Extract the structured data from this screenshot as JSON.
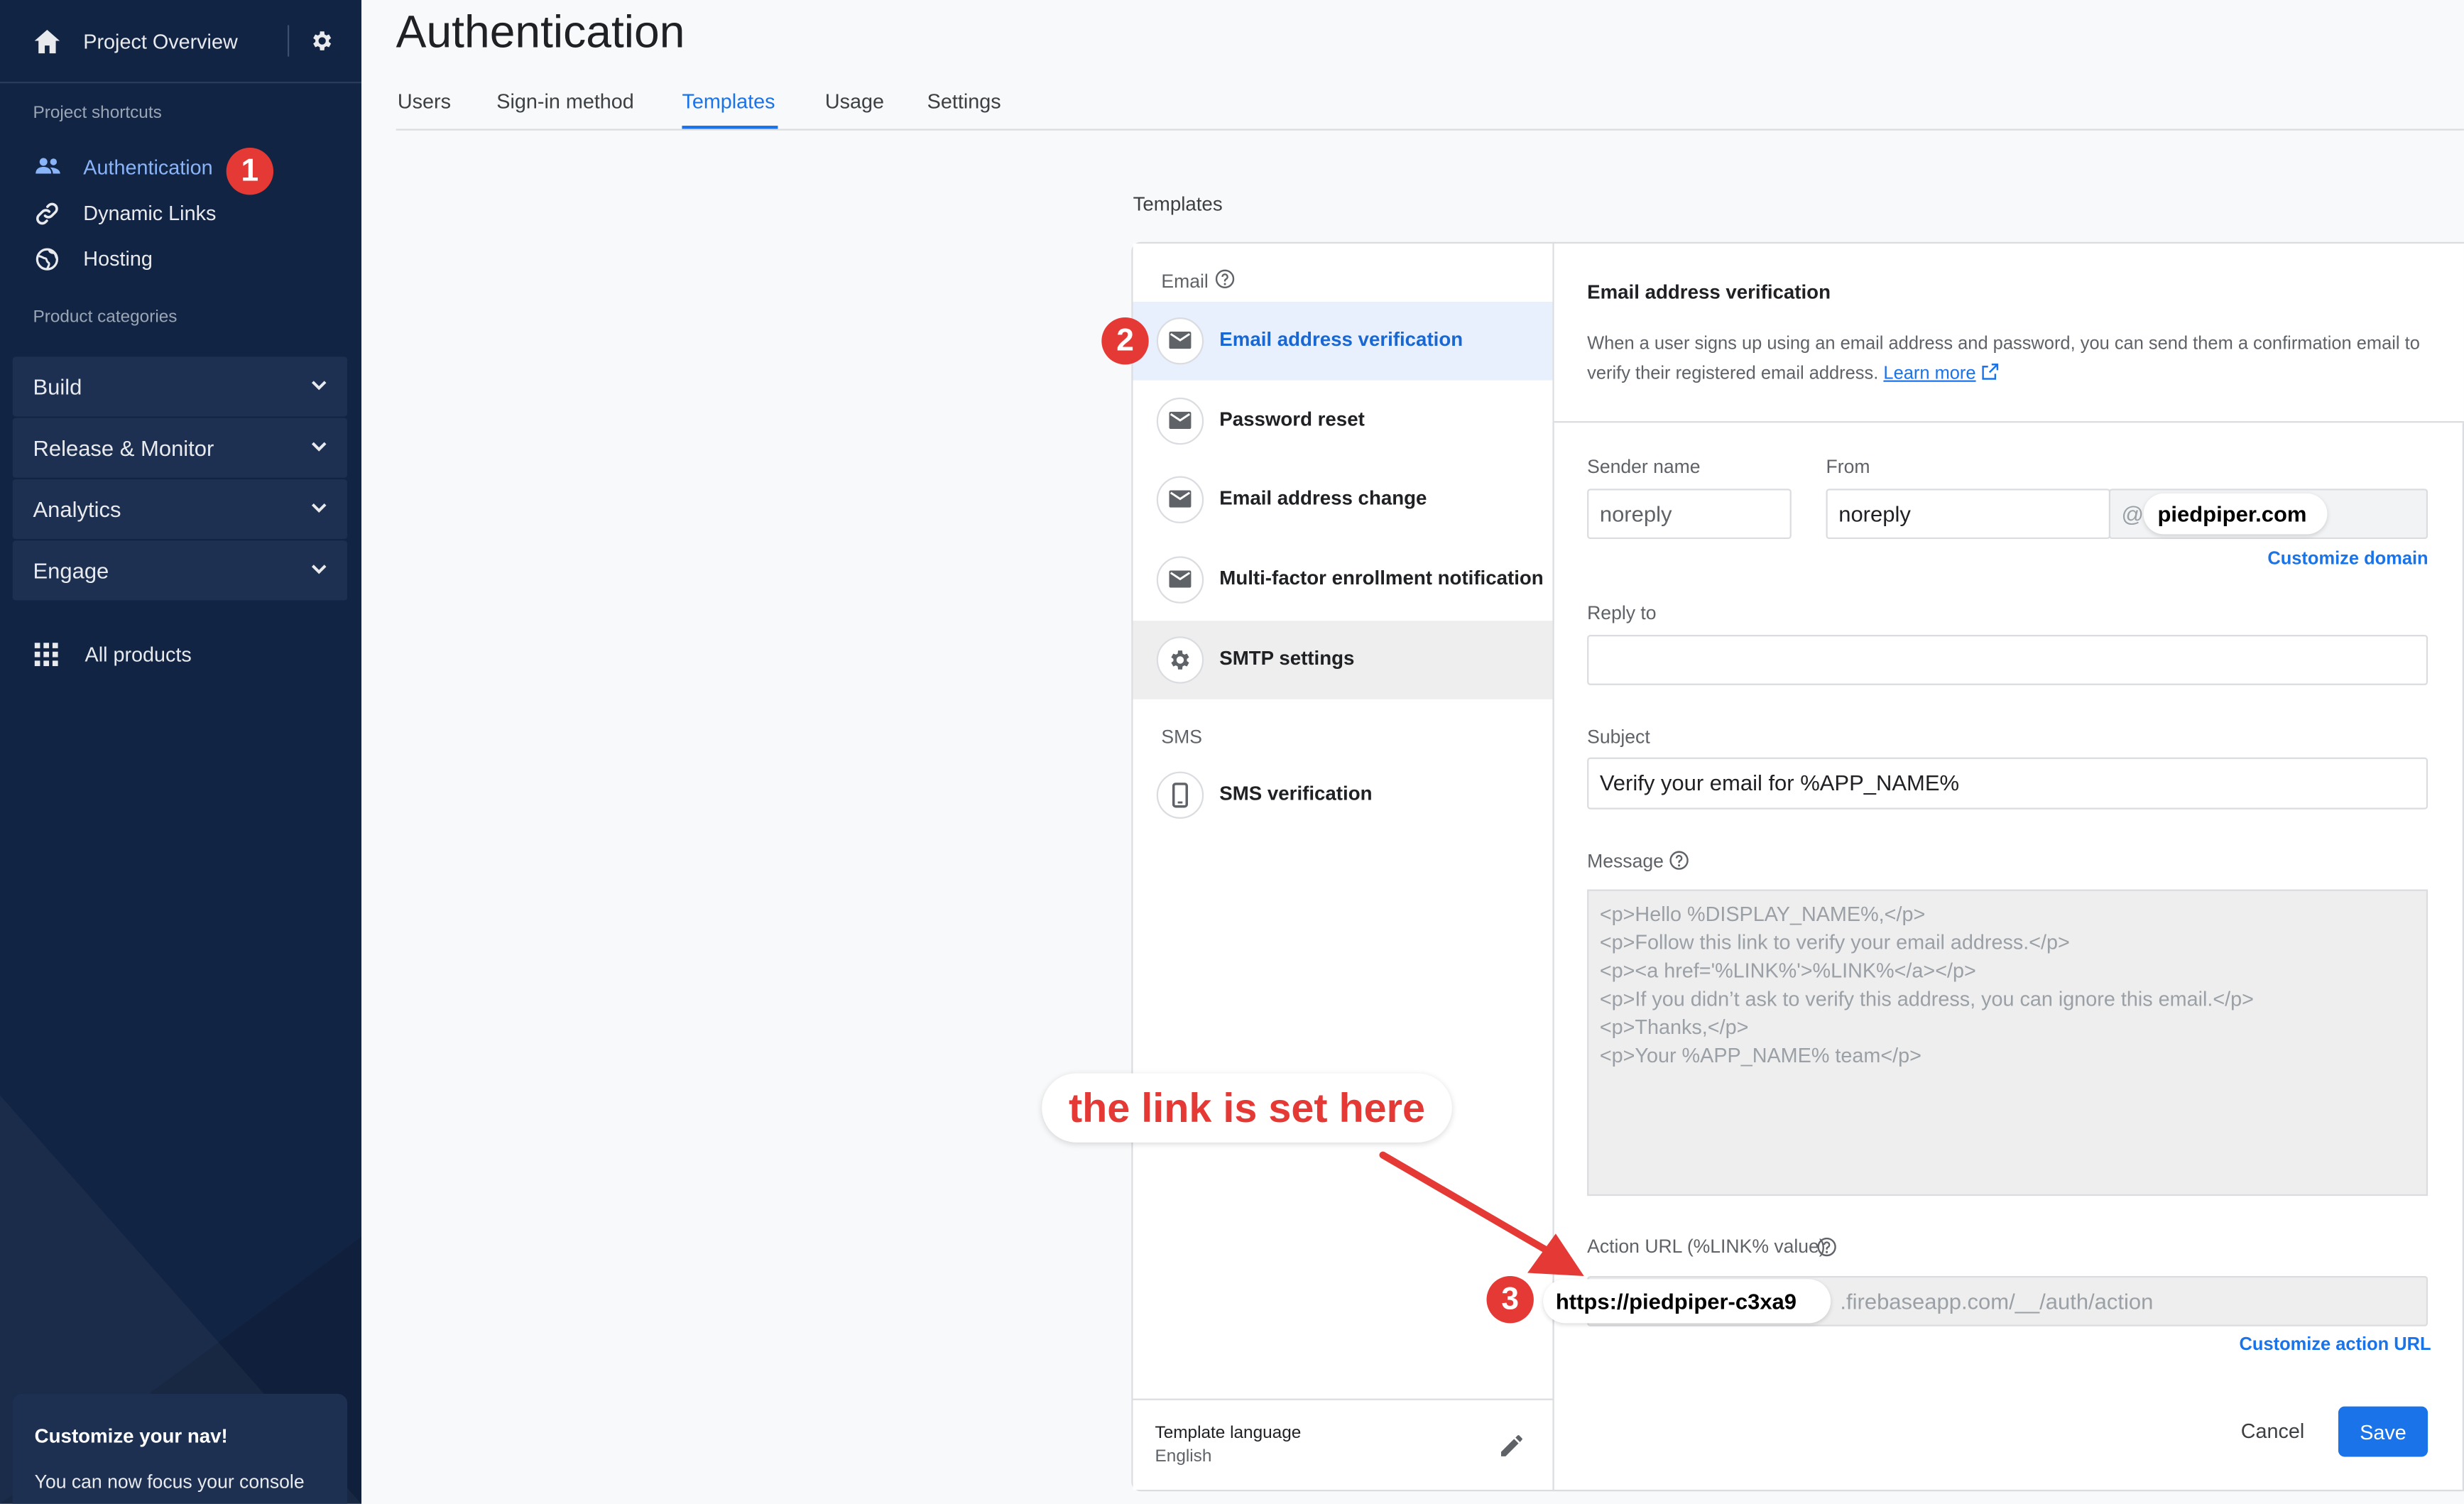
{
  "sidebar": {
    "project_overview": "Project Overview",
    "shortcuts_caption": "Project shortcuts",
    "shortcuts": [
      {
        "label": "Authentication",
        "icon": "users-icon"
      },
      {
        "label": "Dynamic Links",
        "icon": "link-icon"
      },
      {
        "label": "Hosting",
        "icon": "globe-icon"
      }
    ],
    "categories_caption": "Product categories",
    "categories": [
      {
        "label": "Build"
      },
      {
        "label": "Release & Monitor"
      },
      {
        "label": "Analytics"
      },
      {
        "label": "Engage"
      }
    ],
    "all_products": "All products",
    "customize": {
      "title": "Customize your nav!",
      "text": "You can now focus your console"
    }
  },
  "header": {
    "title": "Authentication",
    "tabs": [
      {
        "label": "Users"
      },
      {
        "label": "Sign-in method"
      },
      {
        "label": "Templates",
        "active": true
      },
      {
        "label": "Usage"
      },
      {
        "label": "Settings"
      }
    ]
  },
  "templates": {
    "section_title": "Templates",
    "email_group": "Email",
    "sms_group": "SMS",
    "items": [
      {
        "label": "Email address verification",
        "icon": "mail-icon",
        "selected": true
      },
      {
        "label": "Password reset",
        "icon": "mail-icon"
      },
      {
        "label": "Email address change",
        "icon": "mail-icon"
      },
      {
        "label": "Multi-factor enrollment notification",
        "icon": "mail-icon"
      },
      {
        "label": "SMTP settings",
        "icon": "gear-icon"
      }
    ],
    "sms_items": [
      {
        "label": "SMS verification",
        "icon": "phone-icon"
      }
    ],
    "language_label": "Template language",
    "language_value": "English"
  },
  "detail": {
    "title": "Email address verification",
    "description": "When a user signs up using an email address and password, you can send them a confirmation email to verify their registered email address.",
    "learn_more": "Learn more",
    "sender_name_label": "Sender name",
    "sender_name_value": "noreply",
    "from_label": "From",
    "from_value": "noreply",
    "from_at": "@",
    "from_domain": "piedpiper.com",
    "customize_domain": "Customize domain",
    "reply_to_label": "Reply to",
    "reply_to_value": "",
    "subject_label": "Subject",
    "subject_value": "Verify your email for %APP_NAME%",
    "message_label": "Message",
    "message_lines": [
      "<p>Hello %DISPLAY_NAME%,</p>",
      "<p>Follow this link to verify your email address.</p>",
      "<p><a href='%LINK%'>%LINK%</a></p>",
      "<p>If you didn’t ask to verify this address, you can ignore this email.</p>",
      "<p>Thanks,</p>",
      "<p>Your %APP_NAME% team</p>"
    ],
    "action_url_label": "Action URL (%LINK% value)",
    "action_url_prefix": "https://piedpiper-c3xa9",
    "action_url_rest": ".firebaseapp.com/__/auth/action",
    "customize_action_url": "Customize action URL",
    "cancel": "Cancel",
    "save": "Save"
  },
  "annotations": {
    "callout": "the link is set here",
    "badges": [
      "1",
      "2",
      "3"
    ],
    "color": "#e53935"
  },
  "colors": {
    "sidebar_bg": "#122443",
    "accent": "#1a73e8",
    "save_button": "#1a73e8"
  }
}
